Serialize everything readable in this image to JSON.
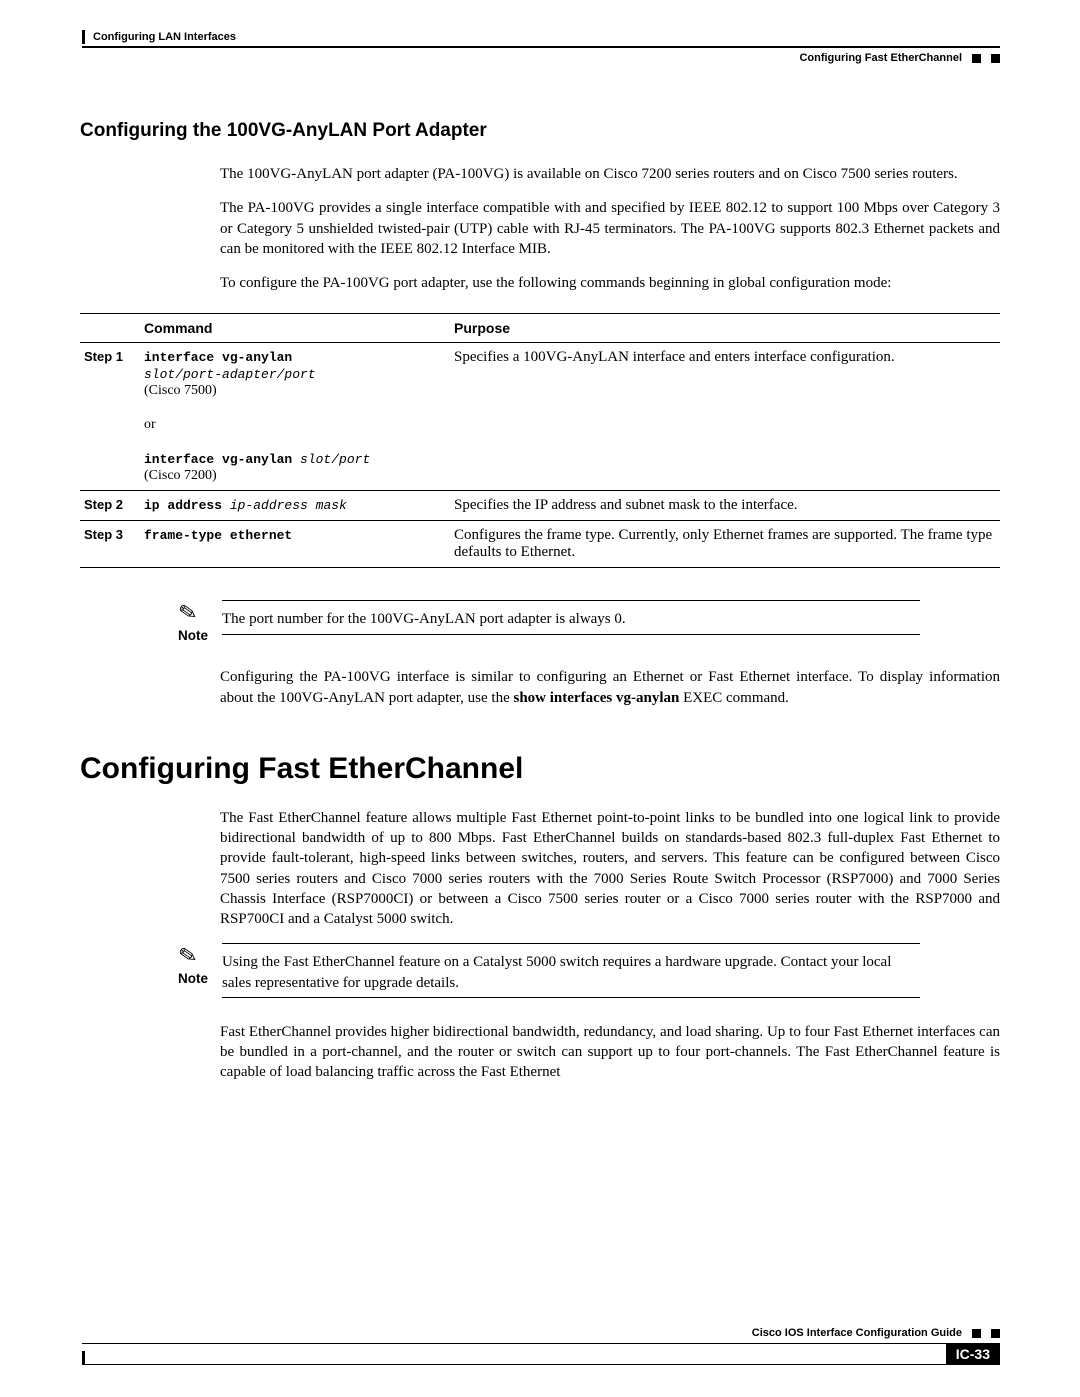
{
  "header": {
    "chapter": "Configuring LAN Interfaces",
    "section": "Configuring Fast EtherChannel"
  },
  "h3": "Configuring the 100VG-AnyLAN Port Adapter",
  "p1": "The 100VG-AnyLAN port adapter (PA-100VG) is available on Cisco 7200 series routers and on Cisco 7500 series routers.",
  "p2": "The PA-100VG provides a single interface compatible with and specified by IEEE 802.12 to support 100 Mbps over Category 3 or Category 5 unshielded twisted-pair (UTP) cable with RJ-45 terminators. The PA-100VG supports 802.3 Ethernet packets and can be monitored with the IEEE 802.12 Interface MIB.",
  "p3": "To configure the PA-100VG port adapter, use the following commands beginning in global configuration mode:",
  "table": {
    "h_cmd": "Command",
    "h_purpose": "Purpose",
    "steps": [
      "Step 1",
      "Step 2",
      "Step 3"
    ],
    "r1": {
      "cmd1_b": "interface vg-anylan",
      "cmd1_i": "slot/port-adapter/port",
      "cmd1_note": "(Cisco 7500)",
      "or": "or",
      "cmd2_b": "interface vg-anylan ",
      "cmd2_i": "slot/port",
      "cmd2_note": "(Cisco 7200)",
      "purpose": "Specifies a 100VG-AnyLAN interface and enters interface configuration."
    },
    "r2": {
      "cmd_b": "ip address ",
      "cmd_i": "ip-address mask",
      "purpose": "Specifies the IP address and subnet mask to the interface."
    },
    "r3": {
      "cmd_b": "frame-type ethernet",
      "purpose": "Configures the frame type. Currently, only Ethernet frames are supported. The frame type defaults to Ethernet."
    }
  },
  "note1": {
    "label": "Note",
    "text": "The port number for the 100VG-AnyLAN port adapter is always 0."
  },
  "p4_a": "Configuring the PA-100VG interface is similar to configuring an Ethernet or Fast Ethernet interface. To display information about the 100VG-AnyLAN port adapter, use the ",
  "p4_b": "show interfaces vg-anylan",
  "p4_c": " EXEC command.",
  "h1": "Configuring Fast EtherChannel",
  "p5": "The Fast EtherChannel feature allows multiple Fast Ethernet point-to-point links to be bundled into one logical link to provide bidirectional bandwidth of up to 800 Mbps. Fast EtherChannel builds on standards-based 802.3 full-duplex Fast Ethernet to provide fault-tolerant, high-speed links between switches, routers, and servers. This feature can be configured between Cisco 7500 series routers and Cisco 7000 series routers with the 7000 Series Route Switch Processor (RSP7000) and 7000 Series Chassis Interface (RSP7000CI) or between a Cisco 7500 series router or a Cisco 7000 series router with the RSP7000 and RSP700CI and a Catalyst 5000 switch.",
  "note2": {
    "label": "Note",
    "text": "Using the Fast EtherChannel feature on a Catalyst 5000 switch requires a hardware upgrade. Contact your local sales representative for upgrade details."
  },
  "p6": "Fast EtherChannel provides higher bidirectional bandwidth, redundancy, and load sharing. Up to four Fast Ethernet interfaces can be bundled in a port-channel, and the router or switch can support up to four port-channels. The Fast EtherChannel feature is capable of load balancing traffic across the Fast Ethernet",
  "footer": {
    "guide": "Cisco IOS Interface Configuration Guide",
    "page": "IC-33"
  }
}
